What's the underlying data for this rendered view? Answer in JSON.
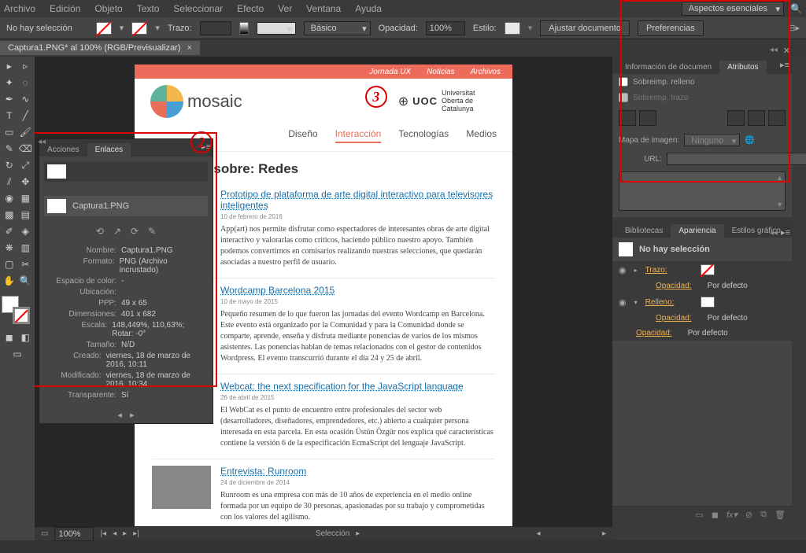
{
  "menubar": {
    "items": [
      "Archivo",
      "Edición",
      "Objeto",
      "Texto",
      "Seleccionar",
      "Efecto",
      "Ver",
      "Ventana",
      "Ayuda"
    ],
    "workspace": "Aspectos esenciales"
  },
  "toolbar": {
    "no_selection": "No hay selección",
    "trazo_label": "Trazo:",
    "stroke_val": "",
    "style_label": "",
    "basic_preset": "Básico",
    "opacity_label": "Opacidad:",
    "opacity_val": "100%",
    "style_drop": "Estilo:",
    "adjust_doc": "Ajustar documento",
    "prefs": "Preferencias"
  },
  "doc_tab": {
    "title": "Captura1.PNG* al 100% (RGB/Previsualizar)"
  },
  "links_panel": {
    "tabs": [
      "Acciones",
      "Enlaces"
    ],
    "active_tab": 1,
    "item": "Captura1.PNG",
    "props": {
      "nombre_l": "Nombre:",
      "nombre_v": "Captura1.PNG",
      "formato_l": "Formato:",
      "formato_v": "PNG (Archivo incrustado)",
      "espacio_l": "Espacio de color:",
      "espacio_v": "-",
      "ubicacion_l": "Ubicación:",
      "ubicacion_v": "",
      "ppp_l": "PPP:",
      "ppp_v": "49 x 65",
      "dim_l": "Dimensiones:",
      "dim_v": "401 x 682",
      "escala_l": "Escala:",
      "escala_v": "148,449%, 110,63%; Rotar: -0°",
      "tam_l": "Tamaño:",
      "tam_v": "N/D",
      "creado_l": "Creado:",
      "creado_v": "viernes, 18 de marzo de 2016, 10:11",
      "mod_l": "Modificado:",
      "mod_v": "viernes, 18 de marzo de 2016, 10:34",
      "trans_l": "Transparente:",
      "trans_v": "Sí"
    }
  },
  "attr_panel": {
    "tabs": [
      "Información de documen",
      "Atributos"
    ],
    "overprint_fill": "Sobreimp. relleno",
    "overprint_stroke": "Sobreimp. trazo",
    "map_label": "Mapa de imagen:",
    "map_val": "Ninguno",
    "url_label": "URL:"
  },
  "appearance": {
    "tabs": [
      "Bibliotecas",
      "Apariencia",
      "Estilos gráfico"
    ],
    "no_sel": "No hay selección",
    "stroke_l": "Trazo:",
    "fill_l": "Relleno:",
    "opacity_l": "Opacidad:",
    "default_v": "Por defecto"
  },
  "webpage": {
    "top_links": [
      "Jornada UX",
      "Noticias",
      "Archivos"
    ],
    "logo": "mosaic",
    "uoc_logo": "UOC",
    "uoc_sub": "Universitat Oberta de Catalunya",
    "nav": [
      "Diseño",
      "Interacción",
      "Tecnologías",
      "Medios"
    ],
    "heading": "Artículos sobre: Redes",
    "articles": [
      {
        "title": "Prototipo de plataforma de arte digital interactivo para televisores inteligentes",
        "date": "10 de febrero de 2016",
        "text": "App(art) nos permite disfrutar como espectadores de interesantes obras de arte digital interactivo y valorarlas como críticos, haciendo público nuestro apoyo. También podemos convertirnos en comisarios realizando nuestras selecciones, que quedarán asociadas a nuestro perfil de usuario.",
        "thumb_bg": "#eaf3fb"
      },
      {
        "title": "Wordcamp Barcelona 2015",
        "date": "10 de mayo de 2015",
        "text": "Pequeño resumen de lo que fueron las jornadas del evento Wordcamp en Barcelona. Este evento está organizado por la Comunidad y para la Comunidad donde se comparte, aprende, enseña y disfruta mediante ponencias de varios de los mismos asistentes. Las ponencias hablan de temas relacionados con el gestor de contenidos Wordpress. El evento transcurrió durante el día 24 y 25 de abril.",
        "thumb_bg": "#22b3c7"
      },
      {
        "title": "Webcat: the next specification for the JavaScript language",
        "date": "26 de abril de 2015",
        "text": "El WebCat es el punto de encuentro entre profesionales del sector web (desarrolladores, diseñadores, emprendedores, etc.) abierto a cualquier persona interesada en esta parcela. En esta ocasión Üstün Özgür nos explica qué características contiene la versión 6 de la especificación EcmaScript del lenguaje JavaScript.",
        "thumb_bg": "#333"
      },
      {
        "title": "Entrevista: Runroom",
        "date": "24 de diciembre de 2014",
        "text": "Runroom es una empresa con más de 10 años de experiencia en el medio online formada por un equipo de 30 personas, apasionadas por su trabajo y comprometidas con los valores del agilismo.",
        "thumb_bg": "#888"
      }
    ]
  },
  "status": {
    "zoom": "100%",
    "seleccion": "Selección"
  },
  "markers": {
    "two": "2",
    "three": "3"
  }
}
